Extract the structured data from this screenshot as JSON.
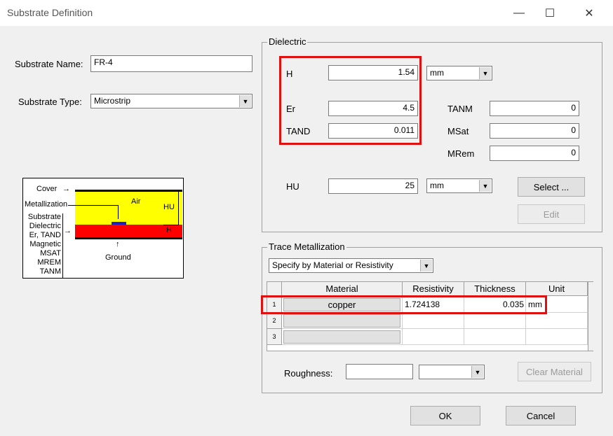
{
  "window": {
    "title": "Substrate Definition",
    "minimize_glyph": "—",
    "maximize_glyph": "☐",
    "close_glyph": "✕"
  },
  "substrate": {
    "name_label": "Substrate Name:",
    "name_value": "FR-4",
    "type_label": "Substrate Type:",
    "type_value": "Microstrip"
  },
  "diagram": {
    "cover": "Cover",
    "metallization": "Metallization",
    "air": "Air",
    "hu": "HU",
    "h": "H",
    "substrate_lines": [
      "Substrate",
      "Dielectric",
      "Er, TAND",
      "Magnetic",
      "MSAT",
      "MREM",
      "TANM"
    ],
    "ground": "Ground",
    "colors": {
      "air": "#ffff00",
      "dielectric": "#ff0000",
      "metal": "#2020c0"
    }
  },
  "dielectric": {
    "group_label": "Dielectric",
    "h_label": "H",
    "h_value": "1.54",
    "h_unit": "mm",
    "er_label": "Er",
    "er_value": "4.5",
    "tand_label": "TAND",
    "tand_value": "0.011",
    "tanm_label": "TANM",
    "tanm_value": "0",
    "msat_label": "MSat",
    "msat_value": "0",
    "mrem_label": "MRem",
    "mrem_value": "0",
    "hu_label": "HU",
    "hu_value": "25",
    "hu_unit": "mm",
    "select_label": "Select ...",
    "edit_label": "Edit"
  },
  "trace": {
    "group_label": "Trace Metallization",
    "spec_mode": "Specify by Material or Resistivity",
    "columns": [
      "Material",
      "Resistivity",
      "Thickness",
      "Unit"
    ],
    "rows": [
      {
        "index": "1",
        "material": "copper",
        "resistivity": "1.724138",
        "thickness": "0.035",
        "unit": "mm"
      },
      {
        "index": "2",
        "material": "",
        "resistivity": "",
        "thickness": "",
        "unit": ""
      },
      {
        "index": "3",
        "material": "",
        "resistivity": "",
        "thickness": "",
        "unit": ""
      }
    ],
    "roughness_label": "Roughness:",
    "roughness_value": "",
    "roughness_unit": "",
    "clear_material_label": "Clear Material"
  },
  "footer": {
    "ok_label": "OK",
    "cancel_label": "Cancel"
  },
  "accent": {
    "highlight": "#e01010"
  }
}
